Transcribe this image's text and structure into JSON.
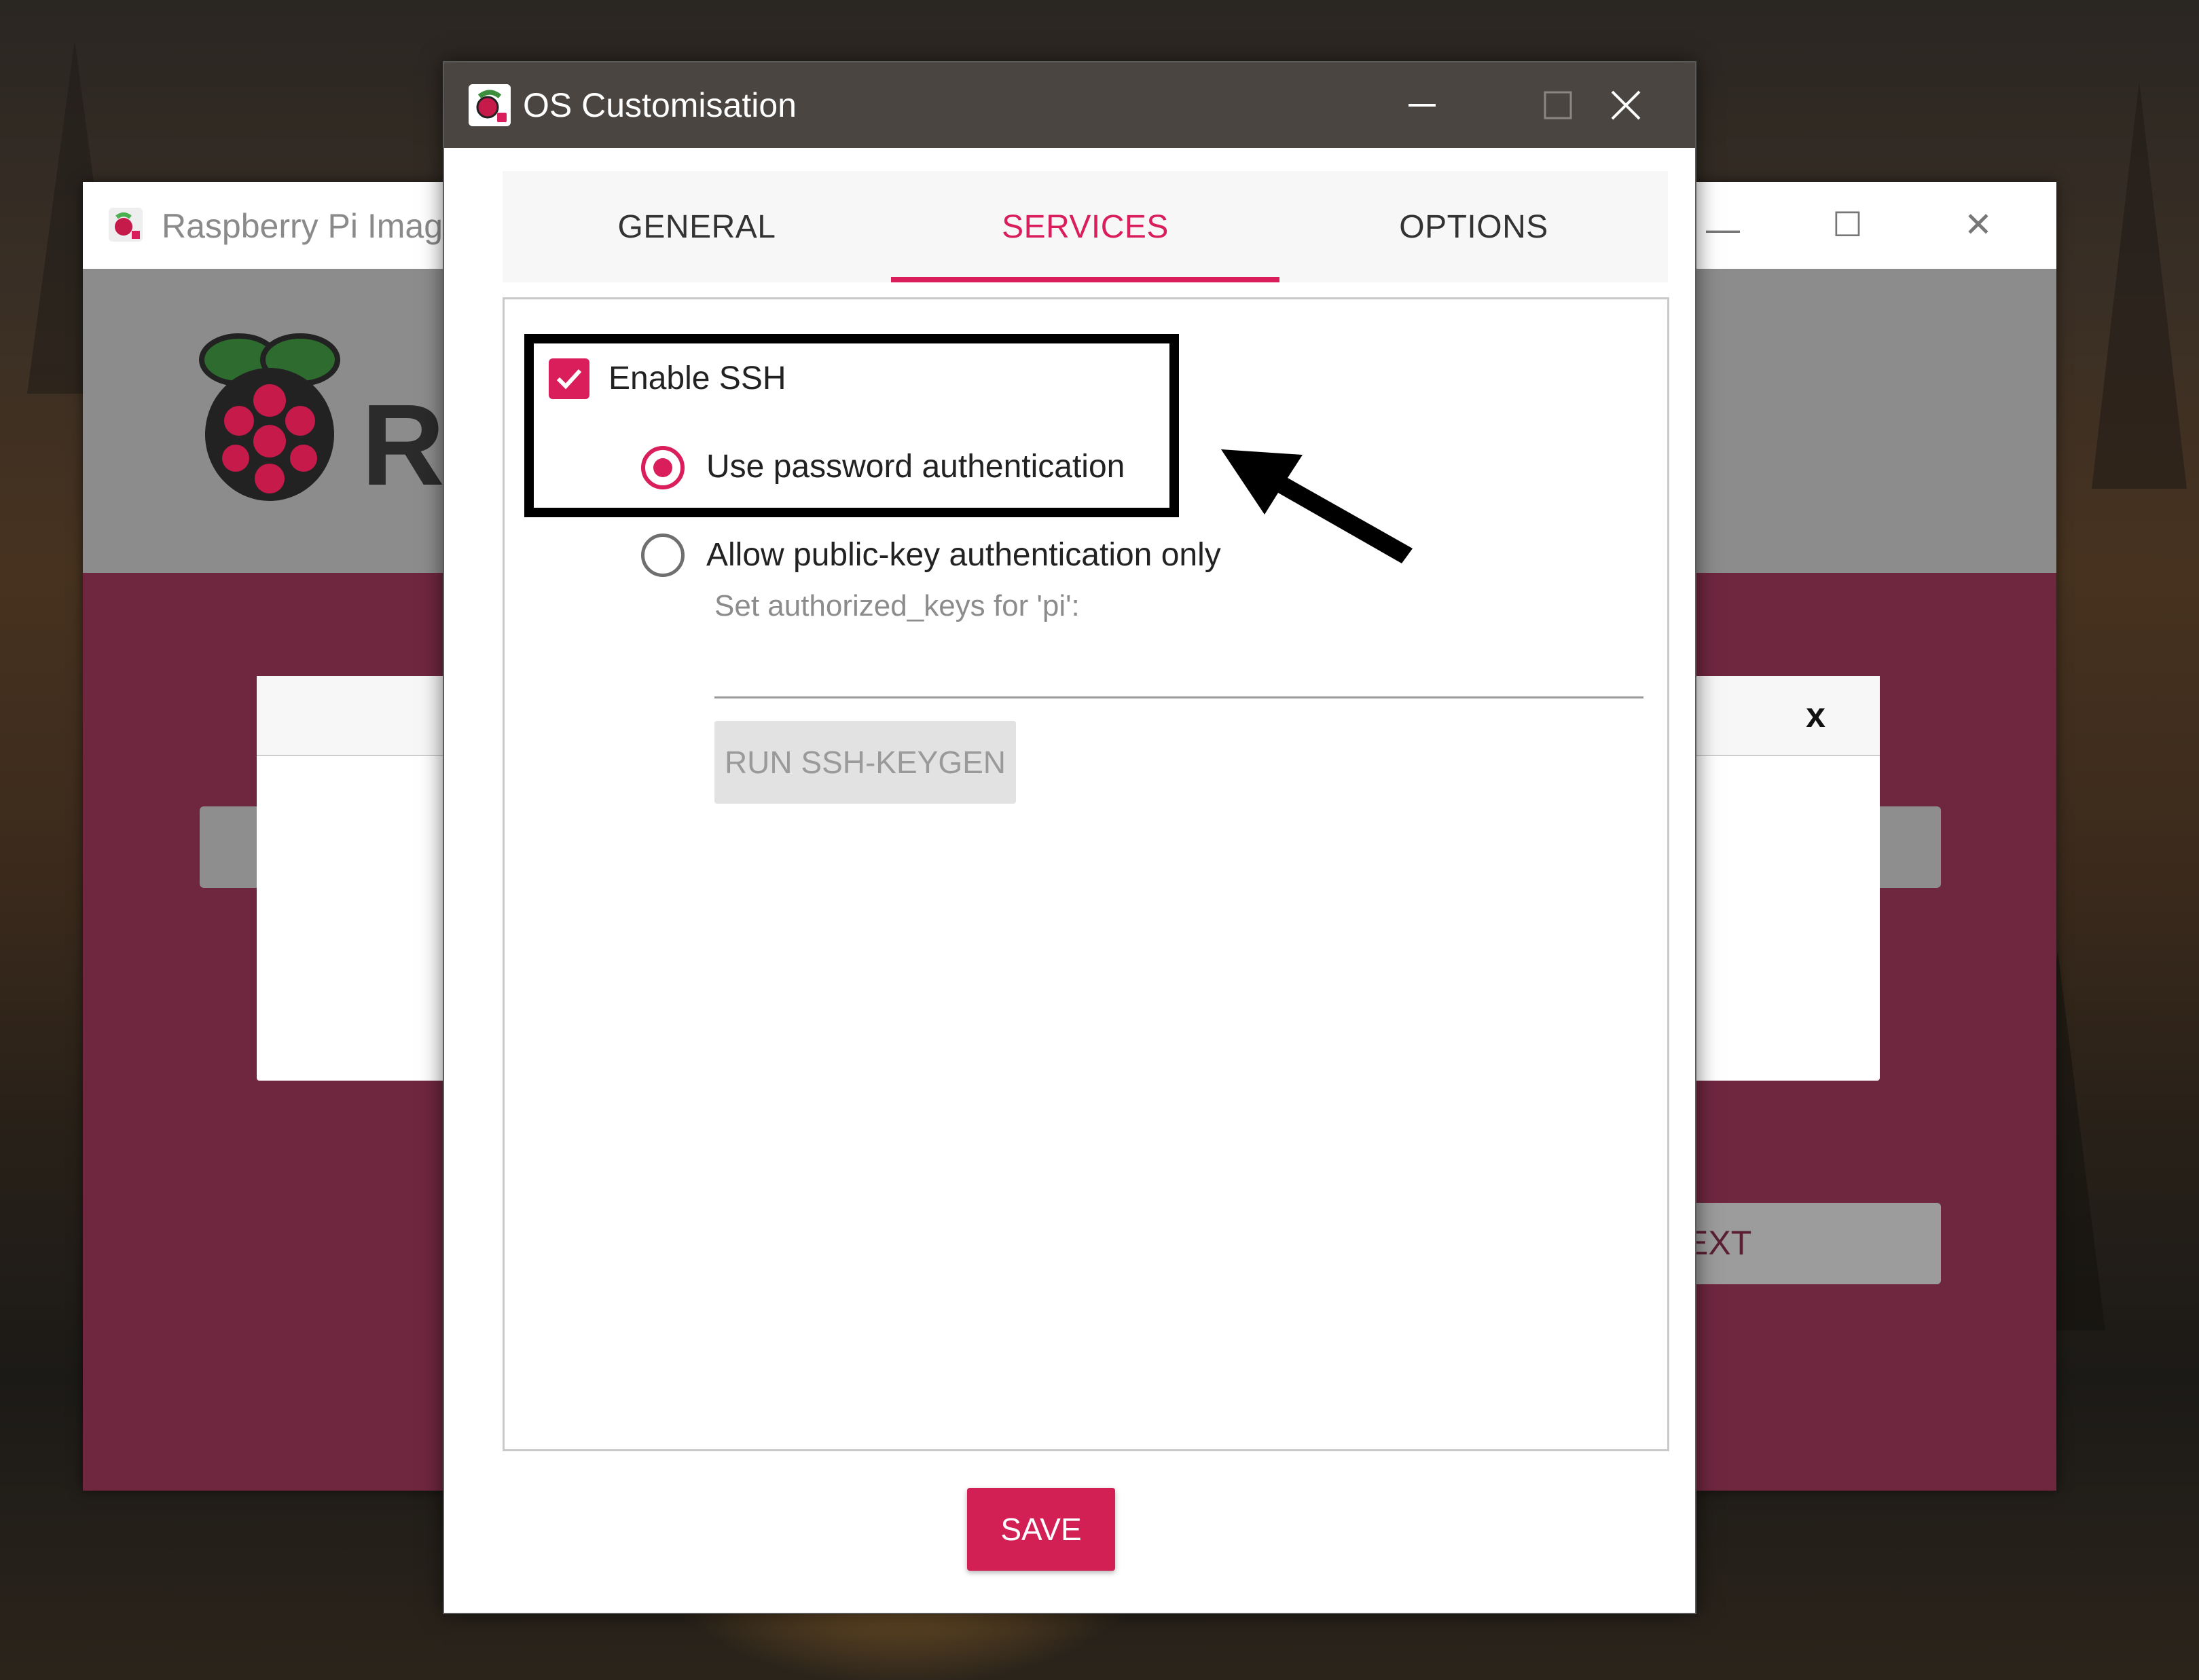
{
  "background_window": {
    "title": "Raspberry Pi Imag",
    "brand_partial": "R",
    "next_partial": "EXT",
    "close_label": "x"
  },
  "dialog": {
    "title": "OS Customisation",
    "tabs": [
      {
        "label": "GENERAL",
        "active": false
      },
      {
        "label": "SERVICES",
        "active": true
      },
      {
        "label": "OPTIONS",
        "active": false
      }
    ],
    "services": {
      "enable_ssh": {
        "label": "Enable SSH",
        "checked": true
      },
      "auth_options": [
        {
          "label": "Use password authentication",
          "selected": true
        },
        {
          "label": "Allow public-key authentication only",
          "selected": false
        }
      ],
      "authorized_keys_label": "Set authorized_keys for 'pi':",
      "authorized_keys_value": "",
      "keygen_button": "RUN SSH-KEYGEN"
    },
    "save_button": "SAVE"
  },
  "colors": {
    "accent": "#d91e5b",
    "titlebar": "#4a4541",
    "bg_window": "#6f2740"
  }
}
